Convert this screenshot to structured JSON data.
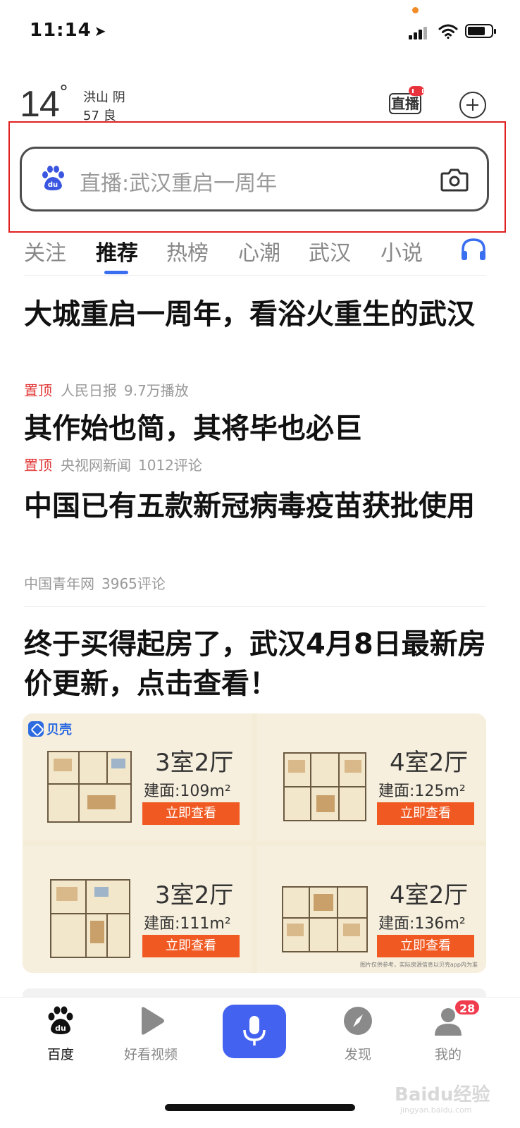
{
  "status_bar": {
    "time": "11:14"
  },
  "weather": {
    "temp": "14",
    "deg": "°",
    "city": "洪山 阴",
    "aqi": "57 良"
  },
  "header": {
    "live_label": "直播"
  },
  "search": {
    "placeholder": "直播:武汉重启一周年"
  },
  "tabs": [
    {
      "label": "关注"
    },
    {
      "label": "推荐"
    },
    {
      "label": "热榜"
    },
    {
      "label": "心潮"
    },
    {
      "label": "武汉"
    },
    {
      "label": "小说"
    }
  ],
  "news": [
    {
      "title": "大城重启一周年，看浴火重生的武汉",
      "pinned": "置顶",
      "source": "人民日报",
      "stat": "9.7万播放"
    },
    {
      "title": "其作始也简，其将毕也必巨",
      "pinned": "置顶",
      "source": "央视网新闻",
      "stat": "1012评论"
    },
    {
      "title": "中国已有五款新冠病毒疫苗获批使用",
      "pinned": "",
      "source": "中国青年网",
      "stat": "3965评论"
    }
  ],
  "ad": {
    "title": "终于买得起房了，武汉4月8日最新房价更新，点击查看！",
    "brand": "贝壳",
    "note": "图片仅供参考，实际房源信息以贝壳app内为准",
    "units": [
      {
        "rooms": "3室2厅",
        "area": "建面:109m²",
        "button": "立即查看"
      },
      {
        "rooms": "4室2厅",
        "area": "建面:125m²",
        "button": "立即查看"
      },
      {
        "rooms": "3室2厅",
        "area": "建面:111m²",
        "button": "立即查看"
      },
      {
        "rooms": "4室2厅",
        "area": "建面:136m²",
        "button": "立即查看"
      }
    ]
  },
  "bottom_nav": {
    "items": [
      {
        "label": "百度",
        "icon": "baidu-paw-icon"
      },
      {
        "label": "好看视频",
        "icon": "play-icon"
      },
      {
        "label": "",
        "icon": "mic-icon"
      },
      {
        "label": "发现",
        "icon": "compass-icon"
      },
      {
        "label": "我的",
        "icon": "user-icon"
      }
    ],
    "badge_count": "28"
  },
  "watermark": {
    "text": "Baidu经验",
    "sub": "jingyan.baidu.com"
  },
  "colors": {
    "accent": "#3a6ef0",
    "pin_red": "#e23b3b",
    "highlight_red": "#e02020",
    "ad_button": "#f05a22",
    "mic_blue": "#4462f0"
  }
}
